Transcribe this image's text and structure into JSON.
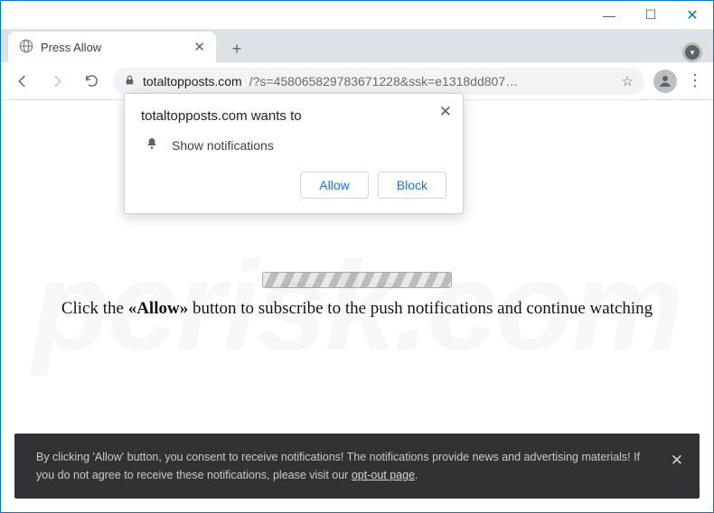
{
  "titlebar": {
    "minimize": "—",
    "maximize": "☐",
    "close": "✕"
  },
  "tab": {
    "title": "Press Allow",
    "close": "✕",
    "new": "+"
  },
  "address": {
    "domain": "totaltopposts.com",
    "path": "/?s=458065829783671228&ssk=e1318dd807…"
  },
  "permission": {
    "title": "totaltopposts.com wants to",
    "line": "Show notifications",
    "allow": "Allow",
    "block": "Block",
    "close": "✕"
  },
  "page": {
    "instruction_pre": "Click the ",
    "instruction_allow": "«Allow»",
    "instruction_post": " button to subscribe to the push notifications and continue watching"
  },
  "consent": {
    "text_a": "By clicking 'Allow' button, you consent to receive notifications! The notifications provide news and advertising materials! If you do not agree to receive these notifications, please visit our ",
    "link": "opt-out page",
    "text_b": ".",
    "close": "✕"
  },
  "watermark": "pcrisk.com"
}
